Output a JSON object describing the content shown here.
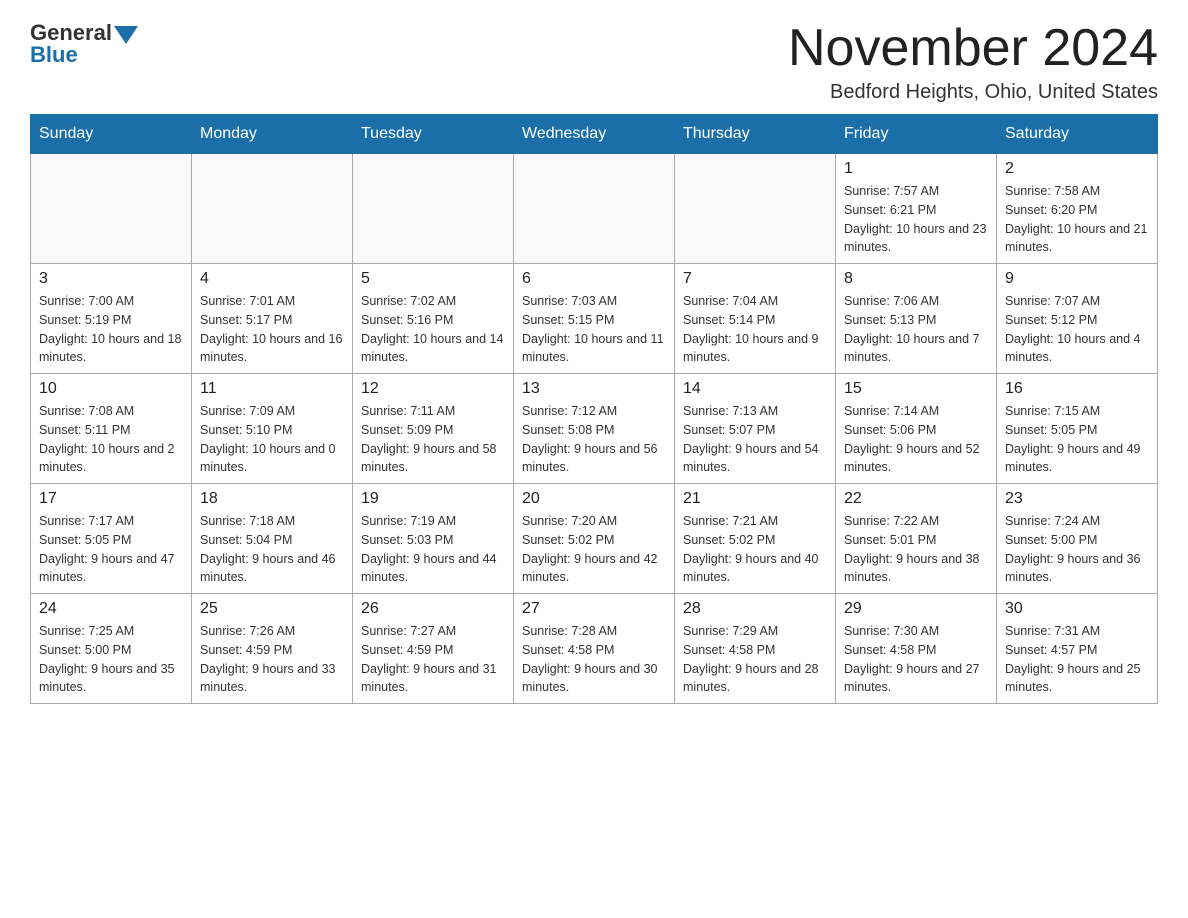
{
  "logo": {
    "general": "General",
    "blue": "Blue"
  },
  "title": {
    "month_year": "November 2024",
    "location": "Bedford Heights, Ohio, United States"
  },
  "weekdays": [
    "Sunday",
    "Monday",
    "Tuesday",
    "Wednesday",
    "Thursday",
    "Friday",
    "Saturday"
  ],
  "weeks": [
    [
      {
        "day": "",
        "sunrise": "",
        "sunset": "",
        "daylight": ""
      },
      {
        "day": "",
        "sunrise": "",
        "sunset": "",
        "daylight": ""
      },
      {
        "day": "",
        "sunrise": "",
        "sunset": "",
        "daylight": ""
      },
      {
        "day": "",
        "sunrise": "",
        "sunset": "",
        "daylight": ""
      },
      {
        "day": "",
        "sunrise": "",
        "sunset": "",
        "daylight": ""
      },
      {
        "day": "1",
        "sunrise": "Sunrise: 7:57 AM",
        "sunset": "Sunset: 6:21 PM",
        "daylight": "Daylight: 10 hours and 23 minutes."
      },
      {
        "day": "2",
        "sunrise": "Sunrise: 7:58 AM",
        "sunset": "Sunset: 6:20 PM",
        "daylight": "Daylight: 10 hours and 21 minutes."
      }
    ],
    [
      {
        "day": "3",
        "sunrise": "Sunrise: 7:00 AM",
        "sunset": "Sunset: 5:19 PM",
        "daylight": "Daylight: 10 hours and 18 minutes."
      },
      {
        "day": "4",
        "sunrise": "Sunrise: 7:01 AM",
        "sunset": "Sunset: 5:17 PM",
        "daylight": "Daylight: 10 hours and 16 minutes."
      },
      {
        "day": "5",
        "sunrise": "Sunrise: 7:02 AM",
        "sunset": "Sunset: 5:16 PM",
        "daylight": "Daylight: 10 hours and 14 minutes."
      },
      {
        "day": "6",
        "sunrise": "Sunrise: 7:03 AM",
        "sunset": "Sunset: 5:15 PM",
        "daylight": "Daylight: 10 hours and 11 minutes."
      },
      {
        "day": "7",
        "sunrise": "Sunrise: 7:04 AM",
        "sunset": "Sunset: 5:14 PM",
        "daylight": "Daylight: 10 hours and 9 minutes."
      },
      {
        "day": "8",
        "sunrise": "Sunrise: 7:06 AM",
        "sunset": "Sunset: 5:13 PM",
        "daylight": "Daylight: 10 hours and 7 minutes."
      },
      {
        "day": "9",
        "sunrise": "Sunrise: 7:07 AM",
        "sunset": "Sunset: 5:12 PM",
        "daylight": "Daylight: 10 hours and 4 minutes."
      }
    ],
    [
      {
        "day": "10",
        "sunrise": "Sunrise: 7:08 AM",
        "sunset": "Sunset: 5:11 PM",
        "daylight": "Daylight: 10 hours and 2 minutes."
      },
      {
        "day": "11",
        "sunrise": "Sunrise: 7:09 AM",
        "sunset": "Sunset: 5:10 PM",
        "daylight": "Daylight: 10 hours and 0 minutes."
      },
      {
        "day": "12",
        "sunrise": "Sunrise: 7:11 AM",
        "sunset": "Sunset: 5:09 PM",
        "daylight": "Daylight: 9 hours and 58 minutes."
      },
      {
        "day": "13",
        "sunrise": "Sunrise: 7:12 AM",
        "sunset": "Sunset: 5:08 PM",
        "daylight": "Daylight: 9 hours and 56 minutes."
      },
      {
        "day": "14",
        "sunrise": "Sunrise: 7:13 AM",
        "sunset": "Sunset: 5:07 PM",
        "daylight": "Daylight: 9 hours and 54 minutes."
      },
      {
        "day": "15",
        "sunrise": "Sunrise: 7:14 AM",
        "sunset": "Sunset: 5:06 PM",
        "daylight": "Daylight: 9 hours and 52 minutes."
      },
      {
        "day": "16",
        "sunrise": "Sunrise: 7:15 AM",
        "sunset": "Sunset: 5:05 PM",
        "daylight": "Daylight: 9 hours and 49 minutes."
      }
    ],
    [
      {
        "day": "17",
        "sunrise": "Sunrise: 7:17 AM",
        "sunset": "Sunset: 5:05 PM",
        "daylight": "Daylight: 9 hours and 47 minutes."
      },
      {
        "day": "18",
        "sunrise": "Sunrise: 7:18 AM",
        "sunset": "Sunset: 5:04 PM",
        "daylight": "Daylight: 9 hours and 46 minutes."
      },
      {
        "day": "19",
        "sunrise": "Sunrise: 7:19 AM",
        "sunset": "Sunset: 5:03 PM",
        "daylight": "Daylight: 9 hours and 44 minutes."
      },
      {
        "day": "20",
        "sunrise": "Sunrise: 7:20 AM",
        "sunset": "Sunset: 5:02 PM",
        "daylight": "Daylight: 9 hours and 42 minutes."
      },
      {
        "day": "21",
        "sunrise": "Sunrise: 7:21 AM",
        "sunset": "Sunset: 5:02 PM",
        "daylight": "Daylight: 9 hours and 40 minutes."
      },
      {
        "day": "22",
        "sunrise": "Sunrise: 7:22 AM",
        "sunset": "Sunset: 5:01 PM",
        "daylight": "Daylight: 9 hours and 38 minutes."
      },
      {
        "day": "23",
        "sunrise": "Sunrise: 7:24 AM",
        "sunset": "Sunset: 5:00 PM",
        "daylight": "Daylight: 9 hours and 36 minutes."
      }
    ],
    [
      {
        "day": "24",
        "sunrise": "Sunrise: 7:25 AM",
        "sunset": "Sunset: 5:00 PM",
        "daylight": "Daylight: 9 hours and 35 minutes."
      },
      {
        "day": "25",
        "sunrise": "Sunrise: 7:26 AM",
        "sunset": "Sunset: 4:59 PM",
        "daylight": "Daylight: 9 hours and 33 minutes."
      },
      {
        "day": "26",
        "sunrise": "Sunrise: 7:27 AM",
        "sunset": "Sunset: 4:59 PM",
        "daylight": "Daylight: 9 hours and 31 minutes."
      },
      {
        "day": "27",
        "sunrise": "Sunrise: 7:28 AM",
        "sunset": "Sunset: 4:58 PM",
        "daylight": "Daylight: 9 hours and 30 minutes."
      },
      {
        "day": "28",
        "sunrise": "Sunrise: 7:29 AM",
        "sunset": "Sunset: 4:58 PM",
        "daylight": "Daylight: 9 hours and 28 minutes."
      },
      {
        "day": "29",
        "sunrise": "Sunrise: 7:30 AM",
        "sunset": "Sunset: 4:58 PM",
        "daylight": "Daylight: 9 hours and 27 minutes."
      },
      {
        "day": "30",
        "sunrise": "Sunrise: 7:31 AM",
        "sunset": "Sunset: 4:57 PM",
        "daylight": "Daylight: 9 hours and 25 minutes."
      }
    ]
  ]
}
